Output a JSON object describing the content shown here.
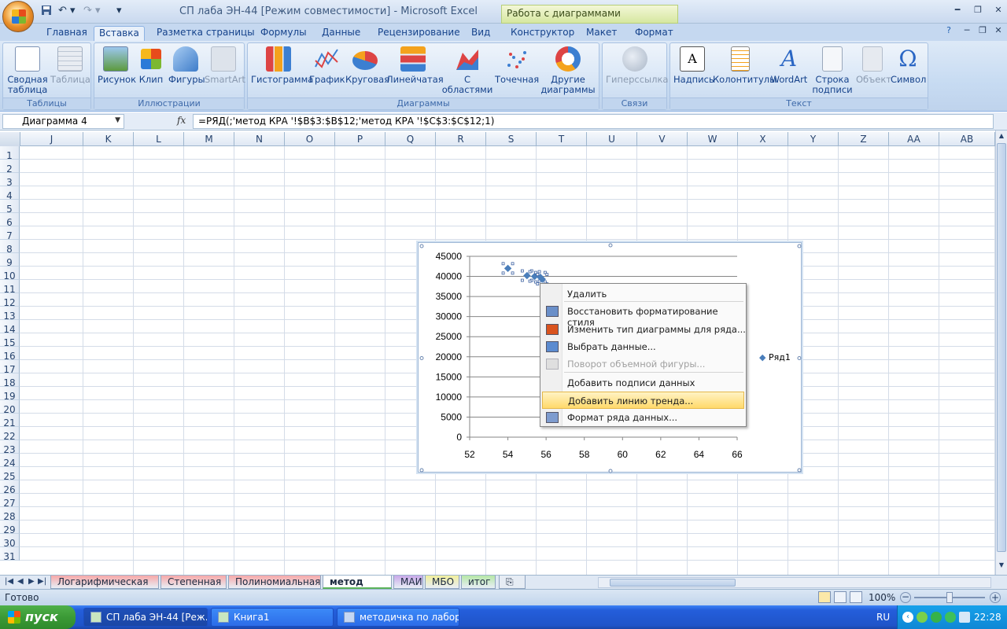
{
  "window": {
    "title": "СП лаба ЭН-44  [Режим совместимости] - Microsoft Excel",
    "context_tab_group": "Работа с диаграммами"
  },
  "ribbon_tabs": [
    "Главная",
    "Вставка",
    "Разметка страницы",
    "Формулы",
    "Данные",
    "Рецензирование",
    "Вид",
    "Конструктор",
    "Макет",
    "Формат"
  ],
  "ribbon": {
    "groups": {
      "tables": {
        "label": "Таблицы",
        "buttons": [
          "Сводная\nтаблица",
          "Таблица"
        ]
      },
      "illustrations": {
        "label": "Иллюстрации",
        "buttons": [
          "Рисунок",
          "Клип",
          "Фигуры",
          "SmartArt"
        ]
      },
      "charts": {
        "label": "Диаграммы",
        "buttons": [
          "Гистограмма",
          "График",
          "Круговая",
          "Линейчатая",
          "С\nобластями",
          "Точечная",
          "Другие\nдиаграммы"
        ]
      },
      "links": {
        "label": "Связи",
        "buttons": [
          "Гиперссылка"
        ]
      },
      "text": {
        "label": "Текст",
        "buttons": [
          "Надпись",
          "Колонтитулы",
          "WordArt",
          "Строка\nподписи",
          "Объект",
          "Символ"
        ]
      }
    }
  },
  "formula_bar": {
    "name_box": "Диаграмма 4",
    "fx": "fx",
    "formula": "=РЯД(;'метод КРА '!$B$3:$B$12;'метод КРА '!$C$3:$C$12;1)"
  },
  "columns": [
    "J",
    "K",
    "L",
    "M",
    "N",
    "O",
    "P",
    "Q",
    "R",
    "S",
    "T",
    "U",
    "V",
    "W",
    "X",
    "Y",
    "Z",
    "AA",
    "AB"
  ],
  "rows": [
    "1",
    "2",
    "3",
    "4",
    "5",
    "6",
    "7",
    "8",
    "9",
    "10",
    "11",
    "12",
    "13",
    "14",
    "15",
    "16",
    "17",
    "18",
    "19",
    "20",
    "21",
    "22",
    "23",
    "24",
    "25",
    "26",
    "27",
    "28",
    "29",
    "30",
    "31"
  ],
  "chart_data": {
    "type": "scatter",
    "title": "",
    "xlabel": "",
    "ylabel": "",
    "xlim": [
      52,
      66
    ],
    "ylim": [
      0,
      45000
    ],
    "x_ticks": [
      "52",
      "54",
      "56",
      "58",
      "60",
      "62",
      "64",
      "66"
    ],
    "y_ticks": [
      "0",
      "5000",
      "10000",
      "15000",
      "20000",
      "25000",
      "30000",
      "35000",
      "40000",
      "45000"
    ],
    "grid": "horizontal",
    "legend_position": "right",
    "series": [
      {
        "name": "Ряд1",
        "color": "#4a7ebb",
        "points": [
          {
            "x": 54.0,
            "y": 42000
          },
          {
            "x": 55.0,
            "y": 40200
          },
          {
            "x": 55.4,
            "y": 40000
          },
          {
            "x": 55.7,
            "y": 39800
          },
          {
            "x": 55.8,
            "y": 39300
          }
        ]
      }
    ]
  },
  "context_menu": {
    "items": [
      {
        "label": "Удалить",
        "icon": "",
        "disabled": false,
        "highlighted": false
      },
      {
        "label": "Восстановить форматирование стиля",
        "icon": "reset-style-icon",
        "disabled": false,
        "highlighted": false
      },
      {
        "label": "Изменить тип диаграммы для ряда...",
        "icon": "chart-type-icon",
        "disabled": false,
        "highlighted": false
      },
      {
        "label": "Выбрать данные...",
        "icon": "select-data-icon",
        "disabled": false,
        "highlighted": false
      },
      {
        "label": "Поворот объемной фигуры...",
        "icon": "rotate-3d-icon",
        "disabled": true,
        "highlighted": false
      },
      {
        "label": "Добавить подписи данных",
        "icon": "",
        "disabled": false,
        "highlighted": false
      },
      {
        "label": "Добавить линию тренда...",
        "icon": "",
        "disabled": false,
        "highlighted": true
      },
      {
        "label": "Формат ряда данных...",
        "icon": "format-series-icon",
        "disabled": false,
        "highlighted": false
      }
    ]
  },
  "sheet_tabs": [
    {
      "label": "Логарифмическая",
      "color": "#f7a8a8",
      "active": false
    },
    {
      "label": "Степенная",
      "color": "#f7a8a8",
      "active": false
    },
    {
      "label": "Полиномиальная",
      "color": "#f7a8a8",
      "active": false
    },
    {
      "label": "метод КРА",
      "color": "#ffffff",
      "active": true
    },
    {
      "label": "МАИ",
      "color": "#c8a8e8",
      "active": false
    },
    {
      "label": "МБО",
      "color": "#f1ef9c",
      "active": false
    },
    {
      "label": "итог",
      "color": "#b6e7a6",
      "active": false
    }
  ],
  "status": {
    "text": "Готово",
    "zoom": "100%"
  },
  "taskbar": {
    "start_label": "пуск",
    "tasks": [
      {
        "label": "СП лаба ЭН-44  [Реж...",
        "active": true
      },
      {
        "label": "Книга1",
        "active": false
      },
      {
        "label": "методичка по лабор...",
        "active": false
      }
    ],
    "language": "RU",
    "clock": "22:28"
  }
}
